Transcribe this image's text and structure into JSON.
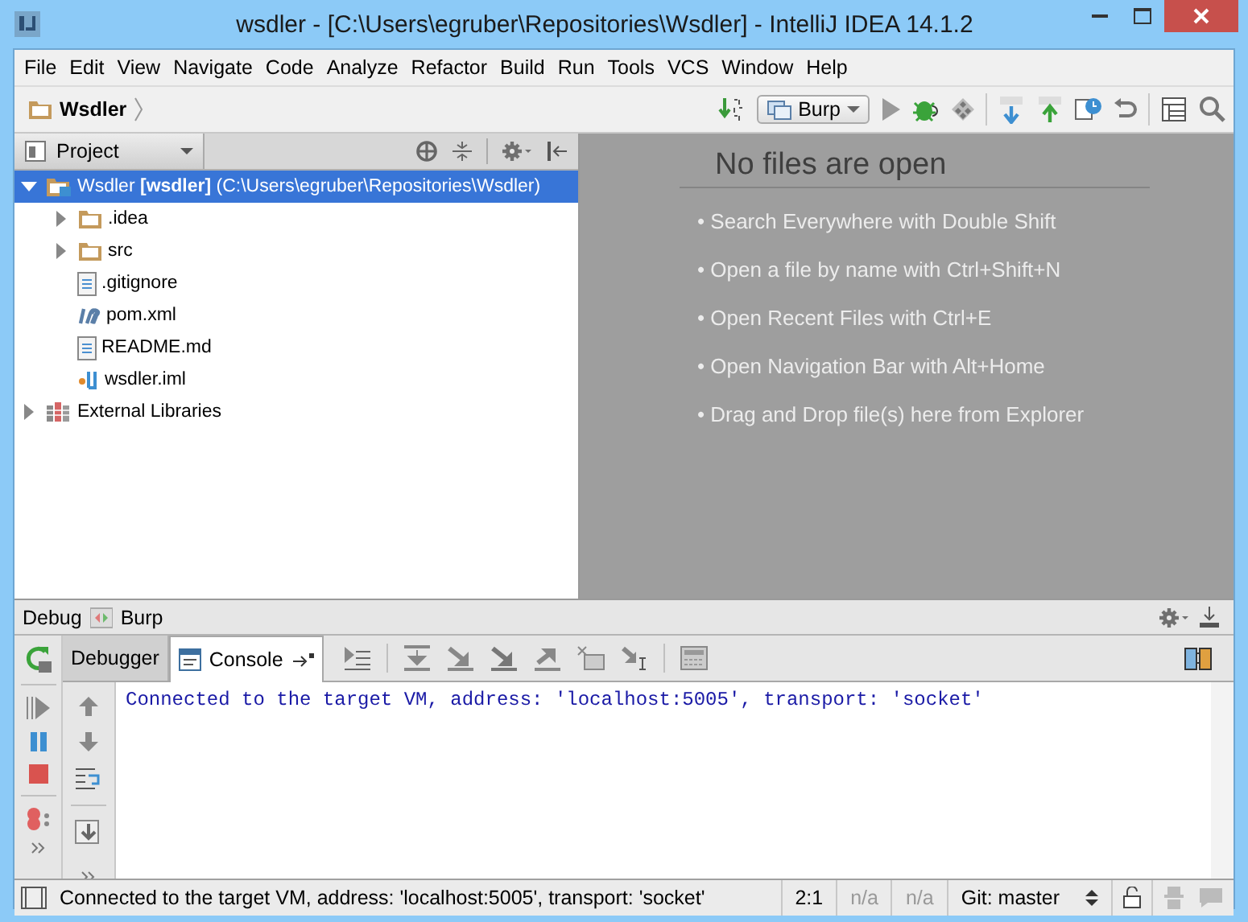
{
  "window": {
    "title": "wsdler - [C:\\Users\\egruber\\Repositories\\Wsdler] - IntelliJ IDEA 14.1.2"
  },
  "menu": [
    {
      "label": "File"
    },
    {
      "label": "Edit"
    },
    {
      "label": "View"
    },
    {
      "label": "Navigate"
    },
    {
      "label": "Code"
    },
    {
      "label": "Analyze"
    },
    {
      "label": "Refactor"
    },
    {
      "label": "Build"
    },
    {
      "label": "Run"
    },
    {
      "label": "Tools"
    },
    {
      "label": "VCS"
    },
    {
      "label": "Window"
    },
    {
      "label": "Help"
    }
  ],
  "navbar": {
    "crumb": "Wsdler",
    "run_config": "Burp"
  },
  "project_panel": {
    "view": "Project",
    "tree": [
      {
        "kind": "module",
        "label": "Wsdler **[wsdler]** (C:\\Users\\egruber\\Repositories\\Wsdler)",
        "expanded": true,
        "selected": true,
        "children": [
          {
            "kind": "folder",
            "label": ".idea",
            "expanded": false,
            "selected": false
          },
          {
            "kind": "folder",
            "label": "src",
            "expanded": false,
            "selected": false
          },
          {
            "kind": "text",
            "label": ".gitignore",
            "selected": false
          },
          {
            "kind": "maven",
            "label": "pom.xml",
            "selected": false
          },
          {
            "kind": "text",
            "label": "README.md",
            "selected": false
          },
          {
            "kind": "iml",
            "label": "wsdler.iml",
            "selected": false
          }
        ]
      },
      {
        "kind": "library",
        "label": "External Libraries",
        "expanded": false,
        "selected": false
      }
    ]
  },
  "editor": {
    "heading": "No files are open",
    "hints": [
      "• Search Everywhere with Double Shift",
      "• Open a file by name with Ctrl+Shift+N",
      "• Open Recent Files with Ctrl+E",
      "• Open Navigation Bar with Alt+Home",
      "• Drag and Drop file(s) here from Explorer"
    ]
  },
  "debug": {
    "label": "Debug",
    "config": "Burp",
    "tabs": [
      {
        "label": "Debugger",
        "selected": false
      },
      {
        "label": "Console",
        "selected": true
      }
    ],
    "console": [
      "Connected to the target VM, address: 'localhost:5005', transport: 'socket'"
    ]
  },
  "status_bar": {
    "message": "Connected to the target VM, address: 'localhost:5005', transport: 'socket'",
    "position": "2:1",
    "fields": [
      "n/a",
      "n/a"
    ],
    "vcs": "Git: master"
  }
}
